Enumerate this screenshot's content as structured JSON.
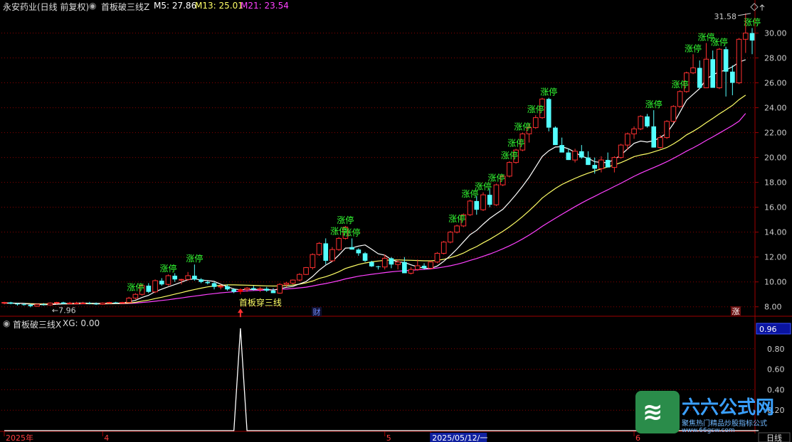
{
  "header": {
    "stock_title": "永安药业(日线 前复权)",
    "indicator_name": "首板破三线Z",
    "m5": "M5: 27.86",
    "m13": "M13: 25.01",
    "m21": "M21: 23.54"
  },
  "sub_header": {
    "indicator_name": "首板破三线X",
    "xg": "XG: 0.00"
  },
  "labels": {
    "limit_up": "涨停",
    "signal": "首板穿三线",
    "low_marker": "←7.96",
    "high_marker": "31.58",
    "cai_badge": "财",
    "zhang_badge": "涨",
    "period_button": "日线"
  },
  "x_axis": {
    "labels": [
      {
        "text": "2025年",
        "index": 0
      },
      {
        "text": "4",
        "index": 15
      },
      {
        "text": "5",
        "index": 58
      },
      {
        "text": "2025/05/12/一",
        "index": 65,
        "highlight": true
      },
      {
        "text": "6",
        "index": 96
      }
    ]
  },
  "watermark": {
    "brand": "六六公式网",
    "slogan": "聚焦热门精品炒股指标公式",
    "domain": "www.66gsw.com"
  },
  "colors": {
    "up": "#ff3030",
    "down": "#54ffff",
    "m5": "#ffffff",
    "m13": "#ffff66",
    "m21": "#ff40ff",
    "grid": "#8a0000",
    "axis_text": "#cccccc",
    "limit_up_text": "#33ff33",
    "signal_box": "#ff0000"
  },
  "chart_data": [
    {
      "type": "candlestick",
      "title": "永安药业(日线 前复权)",
      "ylim": [
        7.3,
        31.8
      ],
      "y_ticks": [
        8.0,
        10.0,
        12.0,
        14.0,
        16.0,
        18.0,
        20.0,
        22.0,
        24.0,
        26.0,
        28.0,
        30.0
      ],
      "grid": true,
      "candles": [
        [
          8.3,
          8.4,
          8.2,
          8.35
        ],
        [
          8.35,
          8.4,
          8.2,
          8.25
        ],
        [
          8.25,
          8.3,
          8.1,
          8.2
        ],
        [
          8.2,
          8.3,
          8.1,
          8.15
        ],
        [
          8.15,
          8.25,
          7.96,
          8.05
        ],
        [
          8.05,
          8.25,
          8.0,
          8.2
        ],
        [
          8.2,
          8.3,
          8.1,
          8.15
        ],
        [
          8.15,
          8.35,
          8.1,
          8.3
        ],
        [
          8.3,
          8.4,
          8.2,
          8.35
        ],
        [
          8.35,
          8.4,
          8.2,
          8.25
        ],
        [
          8.25,
          8.4,
          8.2,
          8.3
        ],
        [
          8.3,
          8.4,
          8.2,
          8.3
        ],
        [
          8.3,
          8.4,
          8.25,
          8.3
        ],
        [
          8.3,
          8.4,
          8.2,
          8.25
        ],
        [
          8.25,
          8.35,
          8.15,
          8.2
        ],
        [
          8.2,
          8.35,
          8.15,
          8.3
        ],
        [
          8.3,
          8.4,
          8.25,
          8.35
        ],
        [
          8.35,
          8.4,
          8.25,
          8.3
        ],
        [
          8.3,
          8.4,
          8.25,
          8.35
        ],
        [
          8.35,
          8.8,
          8.3,
          8.7
        ],
        [
          8.7,
          9.1,
          8.6,
          9.0
        ],
        [
          9.0,
          9.8,
          8.9,
          9.7
        ],
        [
          9.7,
          9.9,
          9.1,
          9.2
        ],
        [
          9.2,
          10.2,
          9.1,
          10.1
        ],
        [
          10.1,
          10.3,
          9.7,
          9.8
        ],
        [
          9.8,
          10.6,
          9.7,
          10.5
        ],
        [
          10.5,
          10.7,
          10.0,
          10.2
        ],
        [
          10.2,
          10.25,
          9.8,
          10.2
        ],
        [
          10.2,
          10.8,
          10.1,
          10.5
        ],
        [
          10.5,
          11.4,
          10.1,
          10.2
        ],
        [
          10.2,
          10.3,
          9.9,
          10.0
        ],
        [
          10.0,
          10.1,
          9.8,
          9.9
        ],
        [
          9.9,
          10.0,
          9.4,
          9.6
        ],
        [
          9.6,
          9.8,
          9.4,
          9.65
        ],
        [
          9.65,
          9.8,
          9.3,
          9.4
        ],
        [
          9.4,
          9.5,
          9.1,
          9.2
        ],
        [
          9.2,
          9.5,
          9.0,
          9.4
        ],
        [
          9.4,
          9.6,
          9.2,
          9.5
        ],
        [
          9.5,
          9.7,
          9.3,
          9.4
        ],
        [
          9.4,
          9.6,
          9.2,
          9.45
        ],
        [
          9.45,
          9.6,
          9.2,
          9.3
        ],
        [
          9.3,
          9.5,
          9.2,
          9.1
        ],
        [
          9.1,
          9.9,
          9.05,
          9.8
        ],
        [
          9.8,
          10.0,
          9.6,
          9.9
        ],
        [
          9.9,
          10.2,
          9.8,
          10.15
        ],
        [
          10.15,
          10.7,
          10.05,
          10.6
        ],
        [
          10.6,
          11.2,
          10.55,
          11.15
        ],
        [
          11.15,
          12.3,
          11.0,
          12.2
        ],
        [
          12.2,
          13.2,
          12.1,
          13.1
        ],
        [
          13.1,
          13.5,
          11.4,
          11.7
        ],
        [
          11.7,
          12.8,
          11.6,
          12.6
        ],
        [
          12.6,
          13.6,
          12.5,
          13.5
        ],
        [
          13.5,
          14.5,
          13.4,
          14.4
        ],
        [
          12.8,
          13.5,
          12.6,
          12.6
        ],
        [
          12.6,
          12.7,
          12.1,
          12.3
        ],
        [
          12.3,
          12.4,
          11.6,
          11.7
        ],
        [
          11.6,
          11.7,
          11.2,
          11.25
        ],
        [
          11.25,
          11.3,
          11.0,
          11.2
        ],
        [
          11.2,
          12.2,
          11.0,
          11.9
        ],
        [
          11.9,
          12.0,
          11.1,
          11.4
        ],
        [
          11.4,
          11.8,
          11.0,
          11.6
        ],
        [
          11.6,
          12.0,
          11.2,
          10.7
        ],
        [
          10.7,
          11.2,
          10.6,
          11.0
        ],
        [
          11.0,
          11.8,
          10.9,
          11.3
        ],
        [
          11.3,
          11.5,
          11.0,
          11.1
        ],
        [
          11.1,
          11.7,
          11.0,
          11.6
        ],
        [
          11.6,
          12.4,
          11.5,
          12.3
        ],
        [
          12.3,
          13.3,
          12.2,
          13.2
        ],
        [
          13.2,
          14.1,
          13.1,
          14.0
        ],
        [
          14.0,
          14.6,
          13.9,
          14.5
        ],
        [
          14.5,
          15.5,
          14.4,
          15.4
        ],
        [
          15.4,
          16.6,
          15.3,
          16.5
        ],
        [
          16.5,
          16.9,
          15.4,
          15.8
        ],
        [
          15.8,
          17.2,
          15.7,
          17.0
        ],
        [
          17.0,
          17.5,
          16.0,
          16.2
        ],
        [
          16.2,
          17.9,
          16.1,
          17.8
        ],
        [
          17.8,
          18.6,
          17.7,
          18.5
        ],
        [
          18.5,
          19.7,
          18.4,
          19.6
        ],
        [
          19.6,
          20.7,
          19.5,
          20.6
        ],
        [
          20.6,
          22.0,
          20.5,
          21.9
        ],
        [
          21.9,
          22.7,
          21.2,
          22.4
        ],
        [
          22.4,
          23.4,
          22.3,
          23.2
        ],
        [
          23.2,
          24.8,
          23.1,
          24.7
        ],
        [
          24.7,
          24.8,
          22.1,
          22.4
        ],
        [
          22.4,
          22.5,
          21.0,
          21.0
        ],
        [
          21.0,
          21.6,
          20.7,
          20.4
        ],
        [
          20.4,
          20.7,
          19.8,
          19.8
        ],
        [
          19.8,
          20.7,
          19.6,
          20.5
        ],
        [
          20.5,
          21.0,
          19.9,
          20.0
        ],
        [
          20.0,
          20.5,
          19.4,
          19.4
        ],
        [
          19.4,
          20.0,
          18.7,
          19.1
        ],
        [
          19.1,
          20.1,
          18.8,
          19.8
        ],
        [
          19.8,
          20.4,
          19.5,
          19.2
        ],
        [
          19.2,
          20.1,
          18.8,
          20.0
        ],
        [
          20.0,
          21.1,
          19.9,
          21.0
        ],
        [
          21.0,
          22.0,
          20.6,
          21.9
        ],
        [
          21.9,
          22.5,
          21.5,
          22.3
        ],
        [
          22.3,
          23.4,
          22.2,
          23.3
        ],
        [
          23.3,
          23.5,
          22.4,
          22.5
        ],
        [
          22.5,
          23.8,
          20.8,
          20.8
        ],
        [
          20.8,
          21.8,
          20.7,
          21.6
        ],
        [
          21.6,
          23.0,
          21.5,
          22.9
        ],
        [
          22.9,
          24.2,
          22.8,
          24.1
        ],
        [
          24.1,
          25.4,
          24.0,
          25.3
        ],
        [
          25.3,
          26.9,
          25.2,
          26.8
        ],
        [
          26.8,
          28.3,
          26.7,
          27.2
        ],
        [
          27.2,
          27.8,
          25.5,
          25.6
        ],
        [
          25.6,
          29.2,
          25.6,
          27.9
        ],
        [
          27.9,
          28.6,
          25.8,
          25.6
        ],
        [
          25.6,
          28.8,
          25.5,
          28.7
        ],
        [
          28.7,
          28.9,
          24.9,
          26.9
        ],
        [
          26.9,
          27.4,
          25.0,
          26.0
        ],
        [
          26.0,
          29.6,
          25.9,
          29.5
        ],
        [
          29.5,
          31.58,
          28.4,
          30.0
        ],
        [
          30.0,
          30.4,
          28.3,
          29.4
        ]
      ],
      "m5": [
        8.3,
        8.3,
        8.28,
        8.27,
        8.2,
        8.19,
        8.17,
        8.18,
        8.21,
        8.25,
        8.27,
        8.3,
        8.31,
        8.29,
        8.27,
        8.27,
        8.28,
        8.29,
        8.31,
        8.4,
        8.52,
        8.75,
        8.92,
        9.22,
        9.42,
        9.61,
        9.79,
        9.98,
        10.18,
        10.25,
        10.15,
        10.11,
        10.04,
        9.82,
        9.62,
        9.43,
        9.37,
        9.41,
        9.39,
        9.4,
        9.4,
        9.34,
        9.45,
        9.57,
        9.64,
        9.84,
        10.03,
        10.44,
        10.94,
        11.35,
        11.65,
        12.16,
        12.72,
        12.73,
        12.88,
        12.97,
        12.62,
        12.26,
        12.15,
        11.8,
        11.6,
        11.57,
        11.37,
        11.22,
        11.1,
        11.08,
        11.28,
        11.66,
        12.12,
        12.64,
        13.22,
        13.8,
        14.14,
        14.64,
        15.1,
        15.47,
        15.84,
        16.41,
        17.02,
        17.69,
        18.4,
        19.24,
        20.08,
        20.54,
        20.84,
        20.87,
        20.7,
        20.42,
        20.1,
        19.94,
        19.66,
        19.6,
        19.59,
        19.84,
        20.2,
        20.68,
        21.14,
        21.32,
        21.24,
        21.35,
        21.61,
        21.96,
        22.72,
        23.65,
        24.6,
        25.07,
        25.54,
        26.29,
        26.65,
        26.88,
        27.03,
        27.29,
        27.66,
        27.86
      ],
      "m13": [
        8.3,
        8.3,
        8.28,
        8.27,
        8.25,
        8.23,
        8.22,
        8.22,
        8.22,
        8.23,
        8.23,
        8.24,
        8.25,
        8.25,
        8.24,
        8.24,
        8.25,
        8.26,
        8.27,
        8.3,
        8.36,
        8.46,
        8.54,
        8.66,
        8.77,
        8.89,
        9.02,
        9.14,
        9.27,
        9.39,
        9.5,
        9.6,
        9.67,
        9.73,
        9.76,
        9.76,
        9.75,
        9.74,
        9.72,
        9.7,
        9.68,
        9.67,
        9.68,
        9.71,
        9.75,
        9.82,
        9.92,
        10.07,
        10.28,
        10.42,
        10.6,
        10.82,
        11.08,
        11.24,
        11.4,
        11.52,
        11.61,
        11.68,
        11.74,
        11.76,
        11.77,
        11.75,
        11.74,
        11.72,
        11.7,
        11.7,
        11.73,
        11.82,
        11.95,
        12.11,
        12.32,
        12.6,
        12.84,
        13.14,
        13.42,
        13.74,
        14.07,
        14.43,
        14.82,
        15.25,
        15.71,
        16.21,
        16.74,
        17.14,
        17.51,
        17.83,
        18.08,
        18.32,
        18.54,
        18.74,
        18.91,
        19.1,
        19.24,
        19.41,
        19.59,
        19.82,
        20.07,
        20.2,
        20.3,
        20.45,
        20.62,
        20.8,
        21.09,
        21.43,
        21.82,
        22.1,
        22.43,
        22.8,
        23.14,
        23.5,
        23.84,
        24.19,
        24.65,
        25.01
      ],
      "m21": [
        8.3,
        8.3,
        8.28,
        8.27,
        8.25,
        8.24,
        8.23,
        8.23,
        8.23,
        8.23,
        8.23,
        8.23,
        8.24,
        8.24,
        8.24,
        8.24,
        8.24,
        8.25,
        8.25,
        8.27,
        8.3,
        8.35,
        8.39,
        8.45,
        8.51,
        8.57,
        8.64,
        8.71,
        8.79,
        8.86,
        8.93,
        9.0,
        9.06,
        9.12,
        9.17,
        9.21,
        9.25,
        9.28,
        9.31,
        9.33,
        9.35,
        9.37,
        9.4,
        9.43,
        9.47,
        9.52,
        9.58,
        9.67,
        9.78,
        9.87,
        9.98,
        10.1,
        10.24,
        10.35,
        10.46,
        10.54,
        10.61,
        10.68,
        10.75,
        10.81,
        10.86,
        10.9,
        10.94,
        10.97,
        11.0,
        11.05,
        11.12,
        11.2,
        11.3,
        11.42,
        11.56,
        11.73,
        11.88,
        12.06,
        12.24,
        12.44,
        12.66,
        12.9,
        13.16,
        13.45,
        13.76,
        14.1,
        14.47,
        14.8,
        15.12,
        15.43,
        15.74,
        16.05,
        16.34,
        16.62,
        16.88,
        17.15,
        17.4,
        17.67,
        17.93,
        18.21,
        18.49,
        18.74,
        18.97,
        19.19,
        19.42,
        19.66,
        19.93,
        20.21,
        20.51,
        20.77,
        21.06,
        21.37,
        21.66,
        21.96,
        22.26,
        22.57,
        22.92,
        23.54
      ],
      "limit_up_days": [
        20,
        25,
        29,
        51,
        52,
        53,
        69,
        71,
        73,
        75,
        77,
        78,
        79,
        81,
        83,
        99,
        103,
        105,
        107,
        109,
        114
      ],
      "signal_day": 36,
      "high_marker": {
        "index": 114,
        "value": 31.58
      },
      "low_marker": {
        "index": 4,
        "value": 7.96
      }
    },
    {
      "type": "line",
      "title": "首板破三线X",
      "ylim": [
        0,
        1
      ],
      "y_ticks": [
        0.2,
        0.4,
        0.6,
        0.8
      ],
      "current_value_badge": "0.96",
      "series": [
        {
          "name": "XG",
          "x_start": 0,
          "values_nonzero": [
            {
              "index": 36,
              "value": 1.0
            }
          ],
          "length": 116
        }
      ]
    }
  ]
}
